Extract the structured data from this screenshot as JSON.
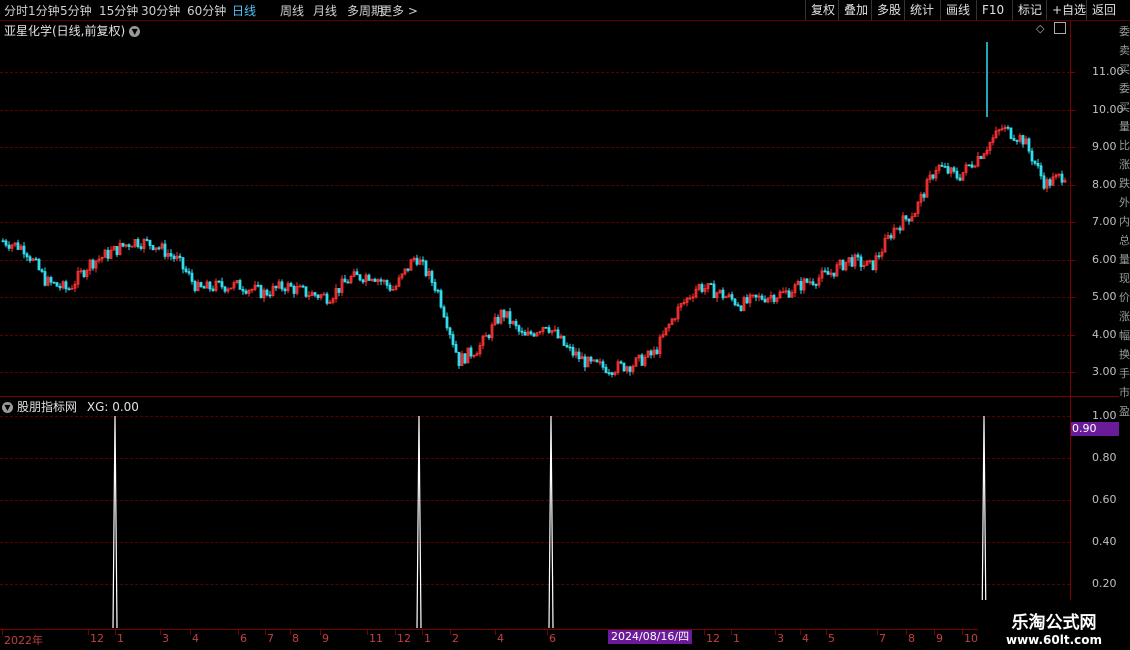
{
  "toolbar": {
    "periods": [
      "分时",
      "1分钟",
      "5分钟",
      "15分钟",
      "30分钟",
      "60分钟",
      "日线",
      "周线",
      "月线",
      "多周期",
      "更多 >"
    ],
    "active_period": "日线",
    "right_buttons": [
      "复权",
      "叠加",
      "多股",
      "统计",
      "画线",
      "F10",
      "标记",
      "+自选",
      "返回"
    ]
  },
  "main_panel": {
    "title": "亚星化学(日线,前复权)",
    "y_ticks": [
      "11.00",
      "10.00",
      "9.00",
      "8.00",
      "7.00",
      "6.00",
      "5.00",
      "4.00",
      "3.00"
    ]
  },
  "indicator_panel": {
    "title": "股朋指标网",
    "xg_label": "XG: 0.00",
    "y_ticks": [
      "1.00",
      "0.80",
      "0.60",
      "0.40",
      "0.20"
    ],
    "highlight_value": "0.90"
  },
  "x_axis": {
    "labels": [
      "2022年",
      "12",
      "1",
      "3",
      "4",
      "6",
      "7",
      "8",
      "9",
      "11",
      "12",
      "1",
      "2",
      "4",
      "6",
      "12",
      "1",
      "3",
      "4",
      "5",
      "7",
      "8",
      "9",
      "10"
    ],
    "cursor_date": "2024/08/16/四"
  },
  "right_ruler_text": "委卖买委买量比涨跌外内总量现价涨幅换手市盈",
  "watermark": {
    "line1": "乐淘公式网",
    "line2": "www.60lt.com"
  },
  "chart_data": [
    {
      "type": "line",
      "title": "亚星化学(日线,前复权)",
      "series": [
        {
          "values": [
            6.5,
            6.3,
            5.4,
            5.2,
            5.9,
            6.2,
            6.5,
            6.4,
            6.0,
            5.2,
            5.3,
            5.3,
            5.1,
            5.3,
            5.1,
            5.0,
            5.5,
            5.6,
            5.2,
            6.1,
            5.2,
            3.3,
            3.7,
            4.6,
            3.9,
            4.3,
            3.6,
            3.2,
            3.1,
            3.2,
            3.5,
            4.6,
            5.3,
            5.1,
            4.8,
            5.0,
            5.1,
            5.4,
            5.6,
            6.0,
            5.8,
            6.8,
            7.3,
            8.5,
            8.2,
            8.8,
            9.5,
            9.2,
            8.0,
            8.3
          ]
        }
      ],
      "ylim": [
        2.6,
        11.9
      ]
    },
    {
      "type": "bar",
      "title": "股朋指标网",
      "series": [
        {
          "name": "XG",
          "values": [
            1,
            1,
            1,
            1
          ]
        }
      ],
      "ylim": [
        0,
        1
      ]
    }
  ]
}
